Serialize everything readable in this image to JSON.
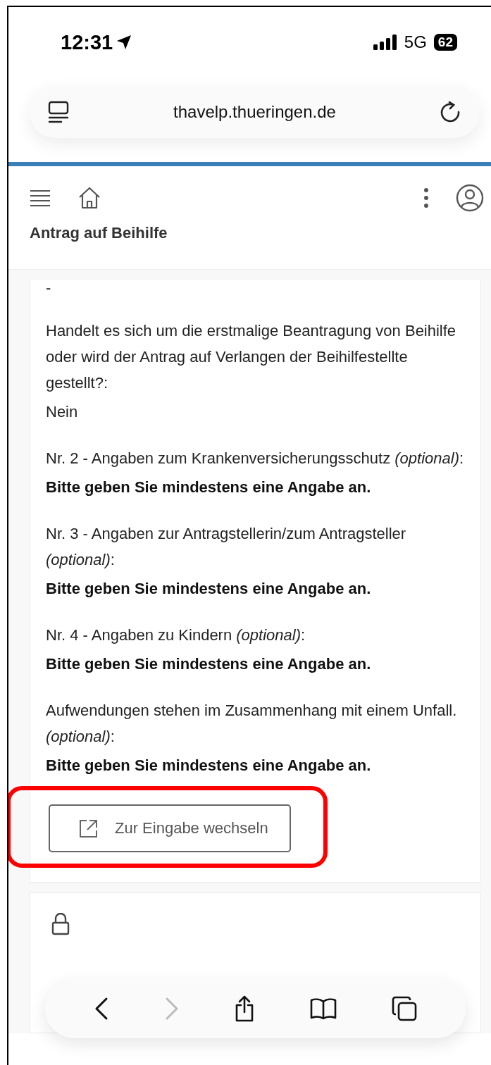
{
  "status_bar": {
    "time": "12:31",
    "network": "5G",
    "battery": "62"
  },
  "address_bar": {
    "url": "thavelp.thueringen.de"
  },
  "page_header": {
    "title": "Antrag auf Beihilfe"
  },
  "summary_card": {
    "leading": "-",
    "fields": [
      {
        "label": "Handelt es sich um die erstmalige Beantragung von Beihilfe oder wird der Antrag auf Verlangen der Beihilfestellte gestellt?:",
        "value": "Nein",
        "kind": "answer"
      },
      {
        "label": "Nr. 2 - Angaben zum Krankenversicherungsschutz *(optional)*:",
        "value": "Bitte geben Sie mindestens eine Angabe an.",
        "kind": "notice"
      },
      {
        "label": "Nr. 3 - Angaben zur Antragstellerin/zum Antragsteller *(optional)*:",
        "value": "Bitte geben Sie mindestens eine Angabe an.",
        "kind": "notice"
      },
      {
        "label": "Nr. 4 - Angaben zu Kindern *(optional)*:",
        "value": "Bitte geben Sie mindestens eine Angabe an.",
        "kind": "notice"
      },
      {
        "label": "Aufwendungen stehen im Zusammenhang mit einem Unfall. *(optional)*:",
        "value": "Bitte geben Sie mindestens eine Angabe an.",
        "kind": "notice"
      }
    ],
    "button": {
      "label": "Zur Eingabe wechseln",
      "highlighted": true
    }
  },
  "next_card": {
    "locked": true
  },
  "toolbar": {
    "back_disabled": false,
    "forward_disabled": true
  }
}
